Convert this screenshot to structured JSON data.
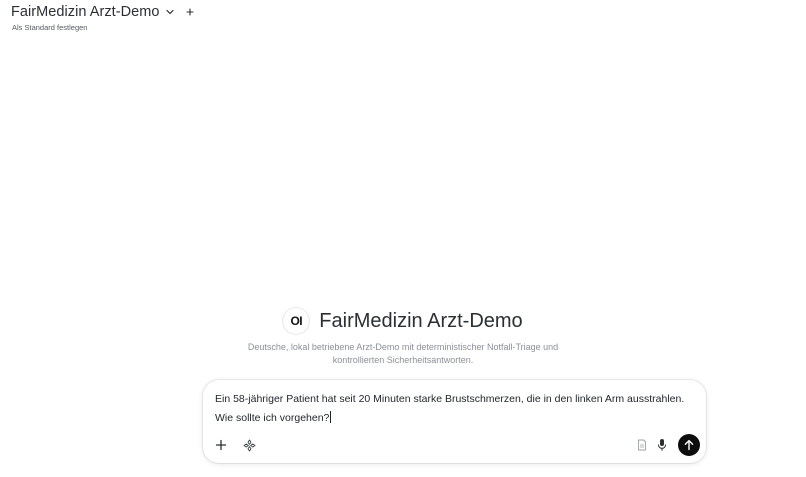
{
  "header": {
    "model_title": "FairMedizin Arzt-Demo",
    "set_default_label": "Als Standard festlegen",
    "icons": {
      "dropdown": "chevron-down-icon",
      "add_model": "plus-icon"
    }
  },
  "hero": {
    "logo_text": "OI",
    "title": "FairMedizin Arzt-Demo",
    "subtitle": "Deutsche, lokal betriebene Arzt-Demo mit deterministischer Notfall-Triage und kontrollierten Sicherheitsantworten."
  },
  "composer": {
    "value": "Ein 58-jähriger Patient hat seit 20 Minuten starke Brustschmerzen, die in den linken Arm ausstrahlen. Wie sollte ich vorgehen?",
    "icons": {
      "attach": "plus-icon",
      "tools": "tools-icon",
      "file": "file-icon",
      "voice": "microphone-icon",
      "send": "arrow-up-icon"
    },
    "colors": {
      "send_bg": "#0d0d0d"
    }
  }
}
